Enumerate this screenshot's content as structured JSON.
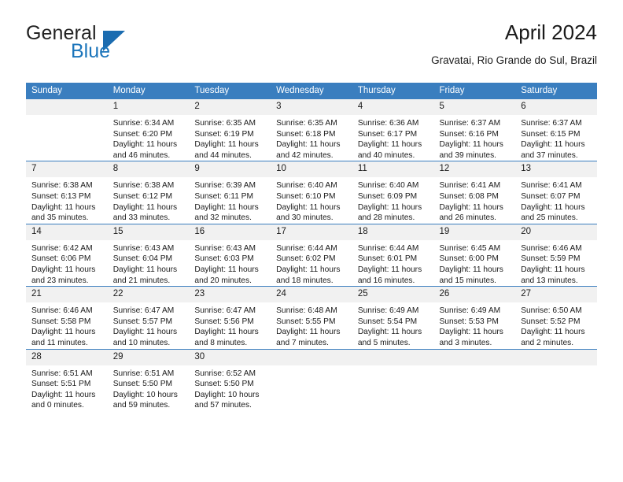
{
  "logo": {
    "word1": "General",
    "word2": "Blue",
    "accent_color": "#1b75bb",
    "triangle_icon": "triangle-icon"
  },
  "header": {
    "title": "April 2024",
    "subtitle": "Gravatai, Rio Grande do Sul, Brazil"
  },
  "calendar": {
    "header_bg": "#3a7ebf",
    "daynum_bg": "#f1f1f1",
    "weekdays": [
      "Sunday",
      "Monday",
      "Tuesday",
      "Wednesday",
      "Thursday",
      "Friday",
      "Saturday"
    ],
    "weeks": [
      [
        {
          "day": "",
          "empty": true
        },
        {
          "day": "1",
          "sunrise": "Sunrise: 6:34 AM",
          "sunset": "Sunset: 6:20 PM",
          "daylight": "Daylight: 11 hours and 46 minutes."
        },
        {
          "day": "2",
          "sunrise": "Sunrise: 6:35 AM",
          "sunset": "Sunset: 6:19 PM",
          "daylight": "Daylight: 11 hours and 44 minutes."
        },
        {
          "day": "3",
          "sunrise": "Sunrise: 6:35 AM",
          "sunset": "Sunset: 6:18 PM",
          "daylight": "Daylight: 11 hours and 42 minutes."
        },
        {
          "day": "4",
          "sunrise": "Sunrise: 6:36 AM",
          "sunset": "Sunset: 6:17 PM",
          "daylight": "Daylight: 11 hours and 40 minutes."
        },
        {
          "day": "5",
          "sunrise": "Sunrise: 6:37 AM",
          "sunset": "Sunset: 6:16 PM",
          "daylight": "Daylight: 11 hours and 39 minutes."
        },
        {
          "day": "6",
          "sunrise": "Sunrise: 6:37 AM",
          "sunset": "Sunset: 6:15 PM",
          "daylight": "Daylight: 11 hours and 37 minutes."
        }
      ],
      [
        {
          "day": "7",
          "sunrise": "Sunrise: 6:38 AM",
          "sunset": "Sunset: 6:13 PM",
          "daylight": "Daylight: 11 hours and 35 minutes."
        },
        {
          "day": "8",
          "sunrise": "Sunrise: 6:38 AM",
          "sunset": "Sunset: 6:12 PM",
          "daylight": "Daylight: 11 hours and 33 minutes."
        },
        {
          "day": "9",
          "sunrise": "Sunrise: 6:39 AM",
          "sunset": "Sunset: 6:11 PM",
          "daylight": "Daylight: 11 hours and 32 minutes."
        },
        {
          "day": "10",
          "sunrise": "Sunrise: 6:40 AM",
          "sunset": "Sunset: 6:10 PM",
          "daylight": "Daylight: 11 hours and 30 minutes."
        },
        {
          "day": "11",
          "sunrise": "Sunrise: 6:40 AM",
          "sunset": "Sunset: 6:09 PM",
          "daylight": "Daylight: 11 hours and 28 minutes."
        },
        {
          "day": "12",
          "sunrise": "Sunrise: 6:41 AM",
          "sunset": "Sunset: 6:08 PM",
          "daylight": "Daylight: 11 hours and 26 minutes."
        },
        {
          "day": "13",
          "sunrise": "Sunrise: 6:41 AM",
          "sunset": "Sunset: 6:07 PM",
          "daylight": "Daylight: 11 hours and 25 minutes."
        }
      ],
      [
        {
          "day": "14",
          "sunrise": "Sunrise: 6:42 AM",
          "sunset": "Sunset: 6:06 PM",
          "daylight": "Daylight: 11 hours and 23 minutes."
        },
        {
          "day": "15",
          "sunrise": "Sunrise: 6:43 AM",
          "sunset": "Sunset: 6:04 PM",
          "daylight": "Daylight: 11 hours and 21 minutes."
        },
        {
          "day": "16",
          "sunrise": "Sunrise: 6:43 AM",
          "sunset": "Sunset: 6:03 PM",
          "daylight": "Daylight: 11 hours and 20 minutes."
        },
        {
          "day": "17",
          "sunrise": "Sunrise: 6:44 AM",
          "sunset": "Sunset: 6:02 PM",
          "daylight": "Daylight: 11 hours and 18 minutes."
        },
        {
          "day": "18",
          "sunrise": "Sunrise: 6:44 AM",
          "sunset": "Sunset: 6:01 PM",
          "daylight": "Daylight: 11 hours and 16 minutes."
        },
        {
          "day": "19",
          "sunrise": "Sunrise: 6:45 AM",
          "sunset": "Sunset: 6:00 PM",
          "daylight": "Daylight: 11 hours and 15 minutes."
        },
        {
          "day": "20",
          "sunrise": "Sunrise: 6:46 AM",
          "sunset": "Sunset: 5:59 PM",
          "daylight": "Daylight: 11 hours and 13 minutes."
        }
      ],
      [
        {
          "day": "21",
          "sunrise": "Sunrise: 6:46 AM",
          "sunset": "Sunset: 5:58 PM",
          "daylight": "Daylight: 11 hours and 11 minutes."
        },
        {
          "day": "22",
          "sunrise": "Sunrise: 6:47 AM",
          "sunset": "Sunset: 5:57 PM",
          "daylight": "Daylight: 11 hours and 10 minutes."
        },
        {
          "day": "23",
          "sunrise": "Sunrise: 6:47 AM",
          "sunset": "Sunset: 5:56 PM",
          "daylight": "Daylight: 11 hours and 8 minutes."
        },
        {
          "day": "24",
          "sunrise": "Sunrise: 6:48 AM",
          "sunset": "Sunset: 5:55 PM",
          "daylight": "Daylight: 11 hours and 7 minutes."
        },
        {
          "day": "25",
          "sunrise": "Sunrise: 6:49 AM",
          "sunset": "Sunset: 5:54 PM",
          "daylight": "Daylight: 11 hours and 5 minutes."
        },
        {
          "day": "26",
          "sunrise": "Sunrise: 6:49 AM",
          "sunset": "Sunset: 5:53 PM",
          "daylight": "Daylight: 11 hours and 3 minutes."
        },
        {
          "day": "27",
          "sunrise": "Sunrise: 6:50 AM",
          "sunset": "Sunset: 5:52 PM",
          "daylight": "Daylight: 11 hours and 2 minutes."
        }
      ],
      [
        {
          "day": "28",
          "sunrise": "Sunrise: 6:51 AM",
          "sunset": "Sunset: 5:51 PM",
          "daylight": "Daylight: 11 hours and 0 minutes."
        },
        {
          "day": "29",
          "sunrise": "Sunrise: 6:51 AM",
          "sunset": "Sunset: 5:50 PM",
          "daylight": "Daylight: 10 hours and 59 minutes."
        },
        {
          "day": "30",
          "sunrise": "Sunrise: 6:52 AM",
          "sunset": "Sunset: 5:50 PM",
          "daylight": "Daylight: 10 hours and 57 minutes."
        },
        {
          "day": "",
          "empty": true
        },
        {
          "day": "",
          "empty": true
        },
        {
          "day": "",
          "empty": true
        },
        {
          "day": "",
          "empty": true
        }
      ]
    ]
  }
}
